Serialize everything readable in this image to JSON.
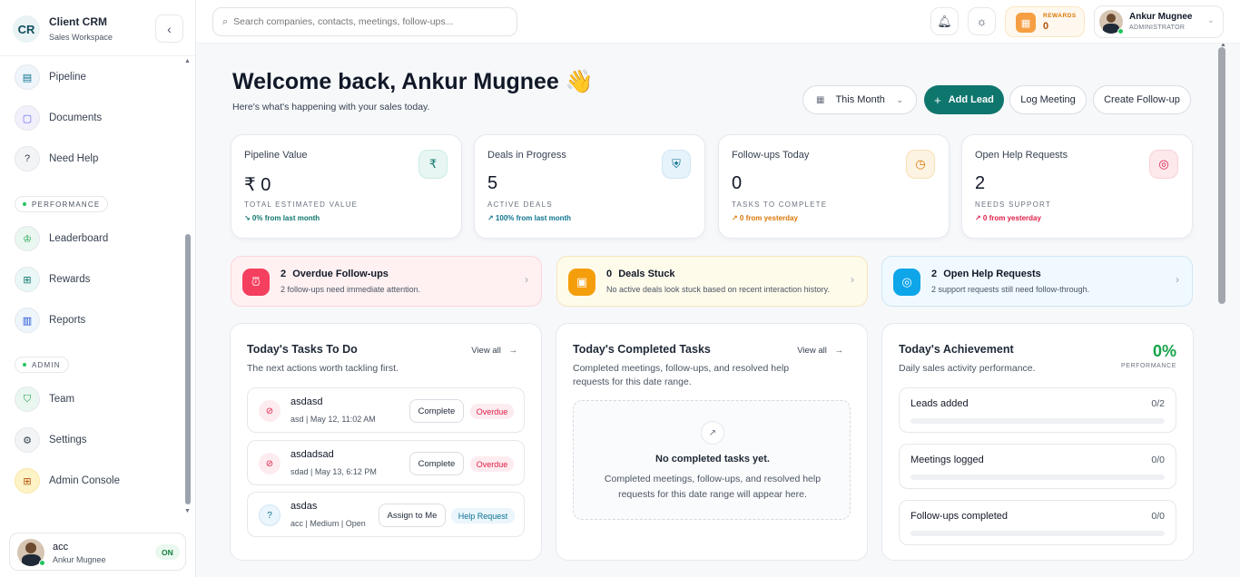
{
  "brand": {
    "title": "Client CRM",
    "subtitle": "Sales Workspace",
    "logo": "CR"
  },
  "sidebar": {
    "items_top": [
      {
        "label": "Pipeline",
        "icon": "pipeline-icon"
      },
      {
        "label": "Documents",
        "icon": "document-icon"
      },
      {
        "label": "Need Help",
        "icon": "help-icon"
      }
    ],
    "section_performance": "PERFORMANCE",
    "items_performance": [
      {
        "label": "Leaderboard",
        "icon": "trophy-icon"
      },
      {
        "label": "Rewards",
        "icon": "gift-icon"
      },
      {
        "label": "Reports",
        "icon": "bar-chart-icon"
      }
    ],
    "section_admin": "ADMIN",
    "items_admin": [
      {
        "label": "Team",
        "icon": "shield-icon"
      },
      {
        "label": "Settings",
        "icon": "gear-icon"
      },
      {
        "label": "Admin Console",
        "icon": "grid-icon"
      }
    ],
    "user": {
      "name": "acc",
      "sub": "Ankur Mugnee",
      "status": "ON"
    }
  },
  "topbar": {
    "search_placeholder": "Search companies, contacts, meetings, follow-ups...",
    "rewards_label": "REWARDS",
    "rewards_value": "0",
    "profile_name": "Ankur Mugnee",
    "profile_role": "ADMINISTRATOR"
  },
  "hero": {
    "title": "Welcome back, Ankur Mugnee 👋",
    "subtitle": "Here's what's happening with your sales today.",
    "period": "This Month",
    "add_lead": "Add Lead",
    "log_meeting": "Log Meeting",
    "create_followup": "Create Follow-up"
  },
  "stats": [
    {
      "title": "Pipeline Value",
      "value": "₹ 0",
      "caption": "TOTAL ESTIMATED VALUE",
      "delta": "↘ 0% from last month",
      "icon": "rupee-icon",
      "color": "#0f766e",
      "bg": "#e8f6f3"
    },
    {
      "title": "Deals in Progress",
      "value": "5",
      "caption": "ACTIVE DEALS",
      "delta": "↗ 100% from last month",
      "icon": "handshake-icon",
      "color": "#0e7490",
      "bg": "#e7f3fb"
    },
    {
      "title": "Follow-ups Today",
      "value": "0",
      "caption": "TASKS TO COMPLETE",
      "delta": "↗ 0 from yesterday",
      "icon": "calendar-clock-icon",
      "color": "#d97706",
      "bg": "#fdf3e2"
    },
    {
      "title": "Open Help Requests",
      "value": "2",
      "caption": "NEEDS SUPPORT",
      "delta": "↗ 0 from yesterday",
      "icon": "lifebuoy-icon",
      "color": "#e11d48",
      "bg": "#fde8ec"
    }
  ],
  "alerts": [
    {
      "count": "2",
      "title": "Overdue Follow-ups",
      "sub": "2 follow-ups need immediate attention.",
      "icon": "alarm-off-icon",
      "color": "#f43f5e",
      "bg": "#fff1f2",
      "border": "#fbd5db"
    },
    {
      "count": "0",
      "title": "Deals Stuck",
      "sub": "No active deals look stuck based on recent interaction history.",
      "icon": "folder-clock-icon",
      "color": "#f59e0b",
      "bg": "#fffbeb",
      "border": "#f6e5bd"
    },
    {
      "count": "2",
      "title": "Open Help Requests",
      "sub": "2 support requests still need follow-through.",
      "icon": "lifebuoy-icon",
      "color": "#0ea5e9",
      "bg": "#f0f9ff",
      "border": "#cfe6f4"
    }
  ],
  "todo": {
    "title": "Today's Tasks To Do",
    "sub": "The next actions worth tackling first.",
    "view_all": "View all",
    "tasks": [
      {
        "name": "asdasd",
        "meta": "asd | May 12, 11:02 AM",
        "action": "Complete",
        "tag": "Overdue"
      },
      {
        "name": "asdadsad",
        "meta": "sdad | May 13, 6:12 PM",
        "action": "Complete",
        "tag": "Overdue"
      },
      {
        "name": "asdas",
        "meta": "acc | Medium | Open",
        "action": "Assign to Me",
        "tag": "Help Request"
      }
    ]
  },
  "completed": {
    "title": "Today's Completed Tasks",
    "sub": "Completed meetings, follow-ups, and resolved help requests for this date range.",
    "view_all": "View all",
    "empty_title": "No completed tasks yet.",
    "empty_sub": "Completed meetings, follow-ups, and resolved help requests for this date range will appear here."
  },
  "achievement": {
    "title": "Today's Achievement",
    "sub": "Daily sales activity performance.",
    "percent": "0%",
    "percent_label": "PERFORMANCE",
    "metrics": [
      {
        "label": "Leads added",
        "value": "0/2",
        "progress": 0
      },
      {
        "label": "Meetings logged",
        "value": "0/0",
        "progress": 0
      },
      {
        "label": "Follow-ups completed",
        "value": "0/0",
        "progress": 0
      }
    ]
  }
}
